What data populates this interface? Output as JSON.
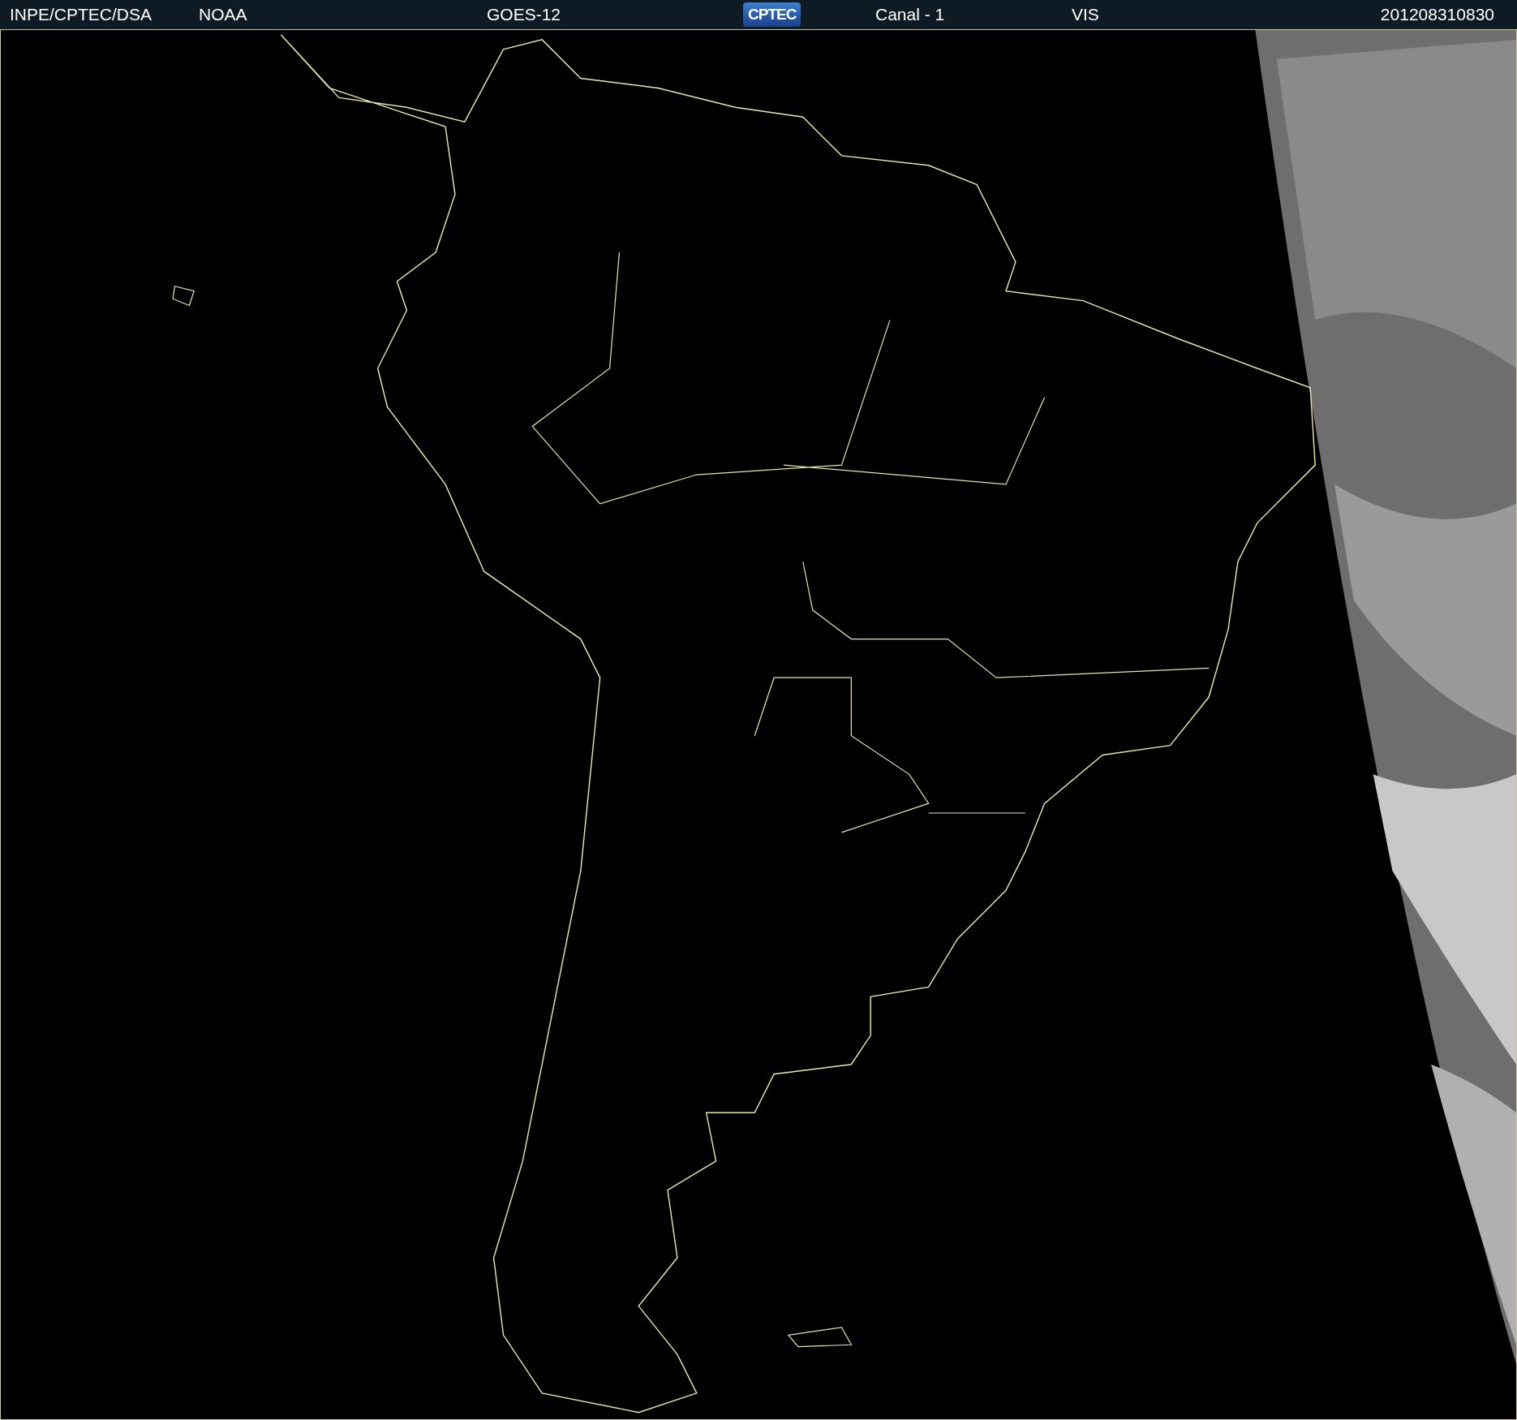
{
  "header": {
    "items": [
      {
        "kind": "text",
        "text": "INPE/CPTEC/DSA"
      },
      {
        "kind": "text",
        "text": "NOAA"
      },
      {
        "kind": "text",
        "text": "GOES-12"
      },
      {
        "kind": "logo",
        "text": "CPTEC"
      },
      {
        "kind": "text",
        "text": "Canal - 1"
      },
      {
        "kind": "text",
        "text": "VIS"
      },
      {
        "kind": "text",
        "text": "201208310830"
      }
    ]
  }
}
